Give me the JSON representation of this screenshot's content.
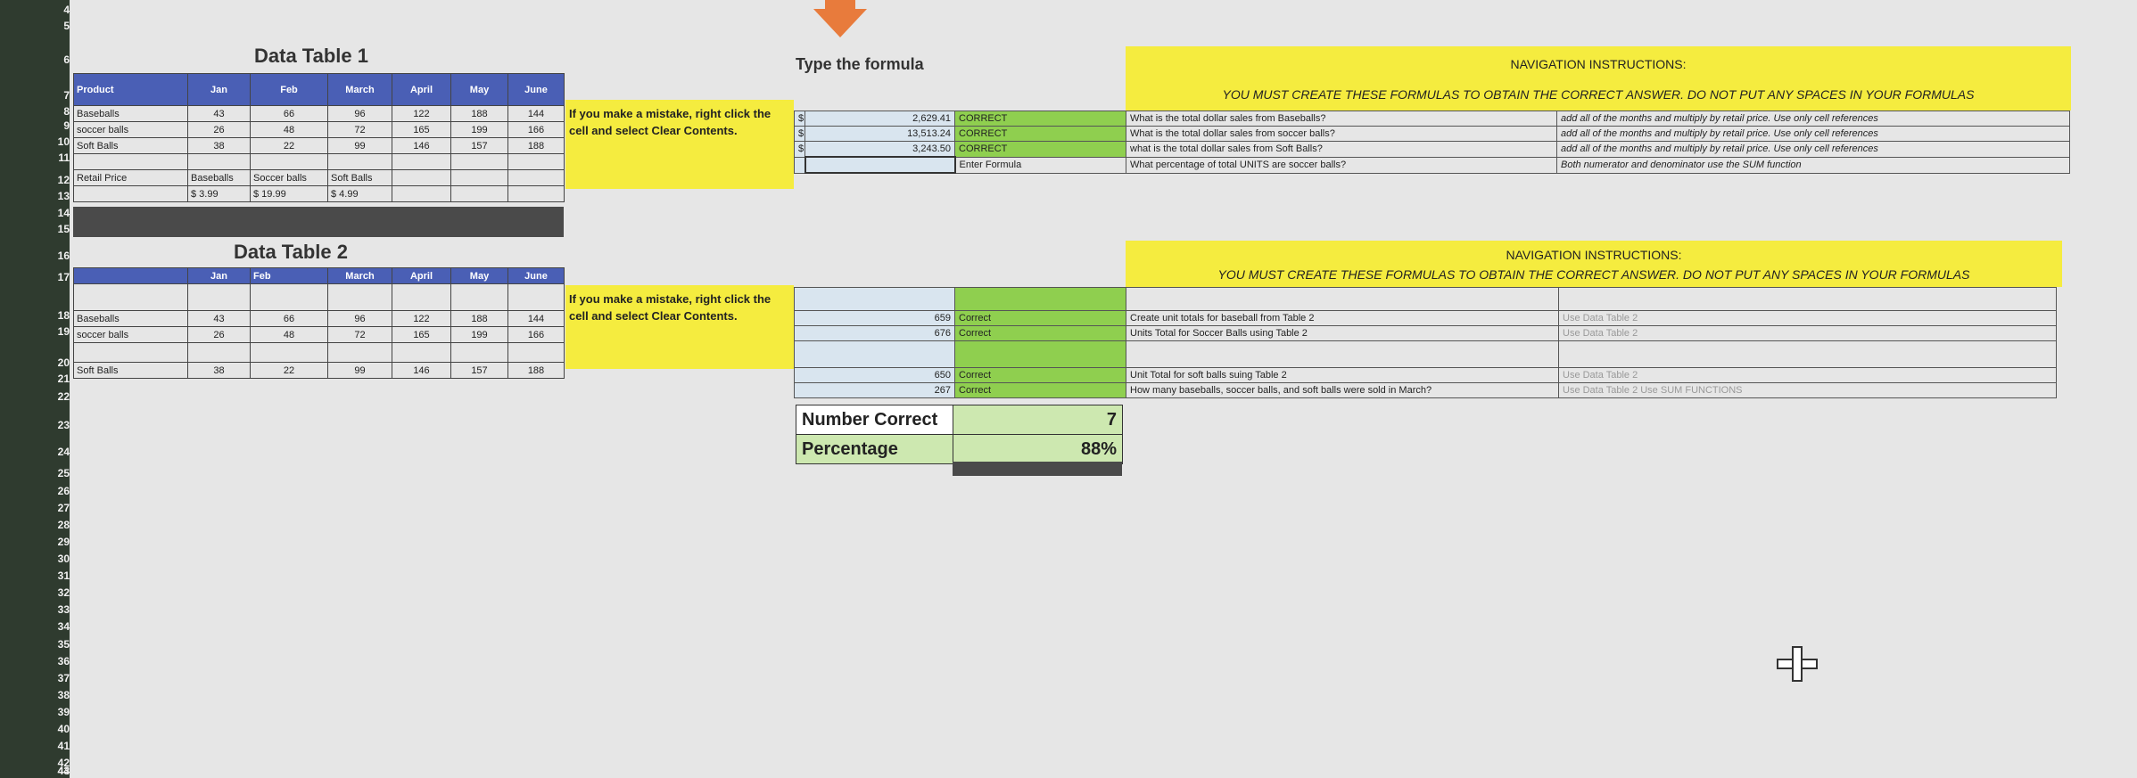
{
  "row_numbers": [
    "4",
    "5",
    "6",
    "7",
    "8",
    "9",
    "10",
    "11",
    "12",
    "13",
    "14",
    "15",
    "16",
    "17",
    "18",
    "19",
    "20",
    "21",
    "22",
    "23",
    "24",
    "25",
    "26",
    "27",
    "28",
    "29",
    "30",
    "31",
    "32",
    "33",
    "34",
    "35",
    "36",
    "37",
    "38",
    "39",
    "40",
    "41",
    "42",
    "43",
    "44"
  ],
  "table1": {
    "title": "Data Table 1",
    "headers": [
      "Product",
      "Jan",
      "Feb",
      "March",
      "April",
      "May",
      "June"
    ],
    "rows": [
      [
        "Baseballs",
        "43",
        "66",
        "96",
        "122",
        "188",
        "144"
      ],
      [
        "soccer balls",
        "26",
        "48",
        "72",
        "165",
        "199",
        "166"
      ],
      [
        "Soft Balls",
        "38",
        "22",
        "99",
        "146",
        "157",
        "188"
      ]
    ],
    "retail_label": "Retail Price",
    "retail_names": [
      "Baseballs",
      "Soccer balls",
      "Soft Balls"
    ],
    "retail_values": [
      "$     3.99",
      "$       19.99",
      "$     4.99"
    ]
  },
  "table2": {
    "title": "Data Table 2",
    "headers": [
      "Jan",
      "Feb",
      "March",
      "April",
      "May",
      "June"
    ],
    "rows": [
      [
        "Baseballs",
        "43",
        "66",
        "96",
        "122",
        "188",
        "144"
      ],
      [
        "soccer balls",
        "26",
        "48",
        "72",
        "165",
        "199",
        "166"
      ],
      [
        "Soft Balls",
        "38",
        "22",
        "99",
        "146",
        "157",
        "188"
      ]
    ]
  },
  "mistake_note": "If you make a mistake, right click the cell and select Clear Contents.",
  "type_formula": "Type the formula",
  "section1": {
    "answers": [
      {
        "cur": "$",
        "value": "2,629.41",
        "status": "CORRECT",
        "question": "What is the total dollar sales from Baseballs?",
        "hint": "add all of the months and multiply by retail price. Use only cell references"
      },
      {
        "cur": "$",
        "value": "13,513.24",
        "status": "CORRECT",
        "question": "What is the total dollar sales from soccer balls?",
        "hint": "add all of the months and multiply by retail price. Use only cell references"
      },
      {
        "cur": "$",
        "value": "3,243.50",
        "status": "CORRECT",
        "question": "what is the total   dollar sales from Soft Balls?",
        "hint": "add all of the months and multiply by retail price. Use only cell references"
      },
      {
        "cur": "",
        "value": "",
        "status": "Enter Formula",
        "question": "What percentage of total UNITS are soccer balls?",
        "hint": "Both numerator and denominator use the SUM function"
      }
    ]
  },
  "nav1": {
    "title": "NAVIGATION INSTRUCTIONS:",
    "subtitle": "YOU MUST CREATE THESE FORMULAS TO OBTAIN THE CORRECT ANSWER. DO NOT PUT ANY SPACES IN YOUR FORMULAS"
  },
  "nav2": {
    "title": "NAVIGATION INSTRUCTIONS:",
    "subtitle": "YOU MUST CREATE THESE FORMULAS TO OBTAIN THE CORRECT ANSWER. DO NOT PUT ANY SPACES IN YOUR FORMULAS"
  },
  "section2": {
    "answers": [
      {
        "value": "659",
        "status": "Correct",
        "question": "Create unit totals for baseball  from Table 2",
        "hint": "Use Data Table 2"
      },
      {
        "value": "676",
        "status": "Correct",
        "question": "Units Total for Soccer Balls using Table 2",
        "hint": "Use Data Table 2"
      },
      {
        "value": "650",
        "status": "Correct",
        "question": "Unit Total for soft balls  suing Table 2",
        "hint": "Use Data Table 2"
      },
      {
        "value": "267",
        "status": "Correct",
        "question": "How many baseballs, soccer balls, and soft balls were sold in March?",
        "hint": "Use Data Table 2 Use SUM FUNCTIONS"
      }
    ]
  },
  "summary": {
    "number_correct_label": "Number Correct",
    "number_correct": "7",
    "percentage_label": "Percentage",
    "percentage": "88%"
  },
  "colors": {
    "yellow": "#f5ec3f",
    "green": "#8fcf4f",
    "header_blue": "#4a5fb5",
    "arrow": "#e87b3c"
  }
}
